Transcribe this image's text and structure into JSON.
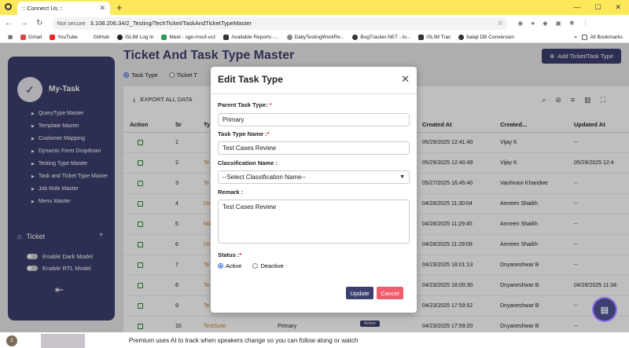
{
  "browser": {
    "tab_title": ":: Connect Us ::",
    "not_secure": "Not secure",
    "url": "3.108.206.34/2_Testing/TechTicket/TaskAndTicketTypeMaster",
    "bookmarks": [
      "Gmail",
      "YouTube",
      "GitHub",
      "iSLIM Log In",
      "Meet - sge-mxof-vcz",
      "Available Reports -...",
      "DailyTestingWorkRe...",
      "BugTracker.NET - lo...",
      "iSLIM Trac",
      "balaji DB Conversion"
    ],
    "all_bookmarks": "All Bookmarks"
  },
  "sidebar": {
    "title": "My-Task",
    "items": [
      "QueryType Master",
      "Template Master",
      "Customer Mapping",
      "Dynamic Form Dropdown",
      "Testing Type Master",
      "Task and Ticket Type Master",
      "Job Role Master",
      "Menu Master"
    ],
    "section": "Ticket",
    "dark_mode": "Enable Dark Model",
    "rtl_mode": "Enable RTL Model"
  },
  "page": {
    "title": "Ticket And Task Type Master",
    "add_button": "Add Ticket/Task Type",
    "radio_task": "Task Type",
    "radio_ticket": "Ticket T",
    "export": "EXPORT ALL DATA"
  },
  "table": {
    "headers": {
      "action": "Action",
      "sr": "Sr",
      "type": "Ty",
      "created_at": "Created At",
      "created_by": "Created...",
      "updated_at": "Updated At"
    },
    "rows": [
      {
        "sr": "1",
        "type": "",
        "created_at": "05/29/2025 12:41:40",
        "created_by": "Vijay K",
        "updated_at": "--"
      },
      {
        "sr": "2",
        "type": "Te",
        "created_at": "05/29/2025 12:40:49",
        "created_by": "Vijay K",
        "updated_at": "05/29/2025 12:4"
      },
      {
        "sr": "3",
        "type": "Te",
        "created_at": "05/27/2025 16:45:40",
        "created_by": "Vaishnavi Khandwe",
        "updated_at": "--"
      },
      {
        "sr": "4",
        "type": "Ds",
        "created_at": "04/28/2025 11:30:04",
        "created_by": "Amreen Shaikh",
        "updated_at": "--"
      },
      {
        "sr": "5",
        "type": "Nd",
        "created_at": "04/28/2025 11:29:45",
        "created_by": "Amreen Shaikh",
        "updated_at": "--"
      },
      {
        "sr": "6",
        "type": "Ds",
        "created_at": "04/28/2025 11:29:08",
        "created_by": "Amreen Shaikh",
        "updated_at": "--"
      },
      {
        "sr": "7",
        "type": "Te",
        "created_at": "04/23/2025 18:01:13",
        "created_by": "Dnyaneshwar B",
        "updated_at": "--"
      },
      {
        "sr": "8",
        "type": "Te",
        "created_at": "04/23/2025 18:00:30",
        "created_by": "Dnyaneshwar B",
        "updated_at": "04/28/2025 11:34:"
      },
      {
        "sr": "9",
        "type": "Te",
        "created_at": "04/23/2025 17:59:52",
        "created_by": "Dnyaneshwar B",
        "updated_at": "--"
      },
      {
        "sr": "10",
        "type": "TestSuite",
        "parent": "Primary",
        "status": "Active",
        "created_at": "04/23/2025 17:59:20",
        "created_by": "Dnyaneshwar B",
        "updated_at": "--"
      }
    ]
  },
  "modal": {
    "title": "Edit Task Type",
    "parent_label": "Parent Task Type:",
    "parent_value": "Primary",
    "name_label": "Task Type Name :",
    "name_value": "Test Cases Review",
    "class_label": "Classification Name :",
    "class_value": "--Select Classification Name--",
    "remark_label": "Remark :",
    "remark_value": "Test Cases Review",
    "status_label": "Status :",
    "active": "Active",
    "deactive": "Deactive",
    "update": "Update",
    "cancel": "Cancel"
  },
  "toast": {
    "text": "Premium uses AI to track when speakers change so you can follow along or watch",
    "avatar": "2"
  }
}
